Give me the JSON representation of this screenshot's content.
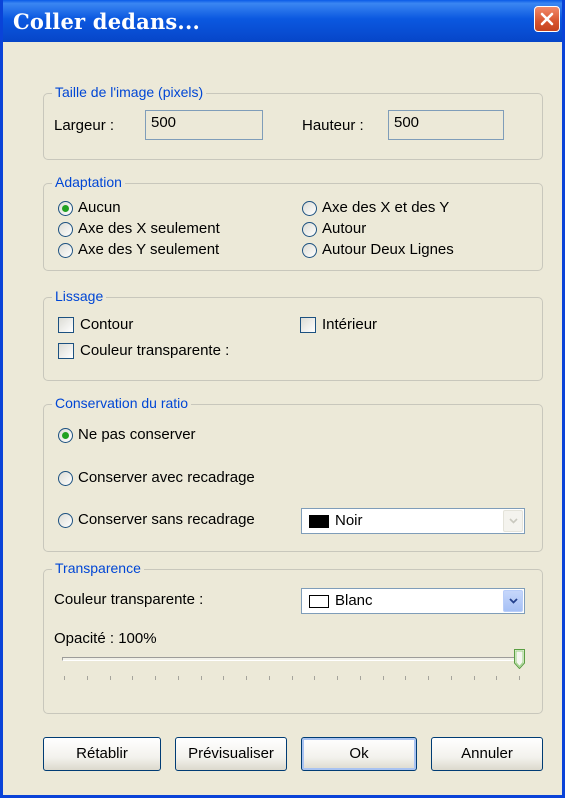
{
  "window": {
    "title": "Coller dedans..."
  },
  "taille": {
    "legend": "Taille de l'image (pixels)",
    "largeur_label": "Largeur :",
    "largeur_value": "500",
    "hauteur_label": "Hauteur :",
    "hauteur_value": "500"
  },
  "adaptation": {
    "legend": "Adaptation",
    "options": [
      "Aucun",
      "Axe des X seulement",
      "Axe des Y seulement",
      "Axe des X et des Y",
      "Autour",
      "Autour Deux Lignes"
    ],
    "selected": "Aucun"
  },
  "lissage": {
    "legend": "Lissage",
    "contour": "Contour",
    "interieur": "Intérieur",
    "couleur_transparente": "Couleur transparente :"
  },
  "ratio": {
    "legend": "Conservation du ratio",
    "options": [
      "Ne pas conserver",
      "Conserver avec recadrage",
      "Conserver sans recadrage"
    ],
    "selected": "Ne pas conserver",
    "color_value": "Noir",
    "color_swatch": "#000000"
  },
  "transparence": {
    "legend": "Transparence",
    "couleur_label": "Couleur transparente :",
    "couleur_value": "Blanc",
    "couleur_swatch": "#ffffff",
    "opacite_label": "Opacité : 100%",
    "opacite_level": 1.0
  },
  "buttons": {
    "retablir": "Rétablir",
    "previsualiser": "Prévisualiser",
    "ok": "Ok",
    "annuler": "Annuler"
  },
  "colors": {
    "legend": "#0046d5",
    "titlebar": "#0a58e0",
    "face": "#ece9d8",
    "radio_dot": "#21a121"
  }
}
